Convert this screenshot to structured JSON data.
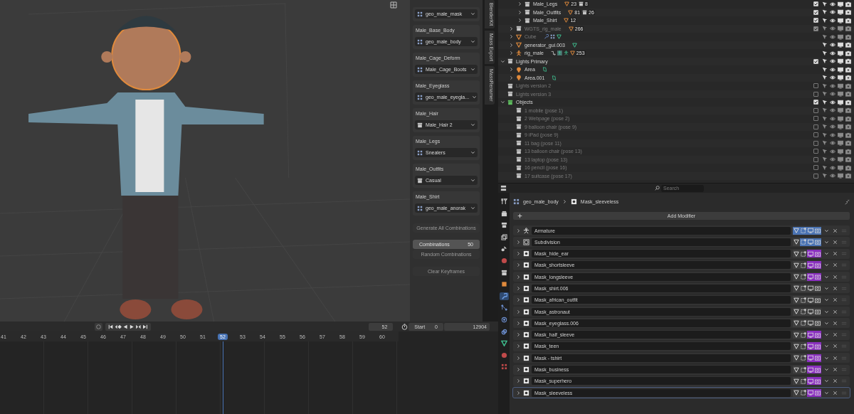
{
  "viewport": {
    "side_panel": {
      "groups": [
        {
          "value": "geo_male_mask",
          "kind": "mesh"
        },
        {
          "label": "Male_Base_Body",
          "value": "geo_male_body",
          "kind": "mesh"
        },
        {
          "label": "Male_Cage_Deform",
          "value": "Male_Cage_Boots",
          "kind": "mesh"
        },
        {
          "label": "Male_Eyeglass",
          "value": "geo_male_eyegla...",
          "kind": "mesh"
        },
        {
          "label": "Male_Hair",
          "value": "Male_Hair 2",
          "kind": "collection"
        },
        {
          "label": "Male_Legs",
          "value": "Snealers",
          "kind": "mesh"
        },
        {
          "label": "Male_Outfits",
          "value": "Casual",
          "kind": "collection"
        },
        {
          "label": "Male_Shirt",
          "value": "geo_male_anorak",
          "kind": "mesh"
        }
      ],
      "actions": [
        {
          "kind": "button",
          "label": "Generate All Combinations",
          "disabled": true
        },
        {
          "kind": "number",
          "label": "Combinations",
          "value": "50",
          "disabled": false
        },
        {
          "kind": "button",
          "label": "Random Combinations",
          "disabled": true
        },
        {
          "kind": "button",
          "label": "Clear Keyframes",
          "disabled": true
        }
      ]
    },
    "tabs": [
      "BlenderKit",
      "Mass Export",
      "MassRenamer"
    ]
  },
  "timeline": {
    "current_frame": "52",
    "start_label": "Start",
    "start": "0",
    "end": "12904",
    "frames": [
      {
        "label": "41",
        "selected": false
      },
      {
        "label": "42",
        "selected": false
      },
      {
        "label": "43",
        "selected": false
      },
      {
        "label": "44",
        "selected": false
      },
      {
        "label": "45",
        "selected": false
      },
      {
        "label": "46",
        "selected": false
      },
      {
        "label": "47",
        "selected": false
      },
      {
        "label": "48",
        "selected": false
      },
      {
        "label": "49",
        "selected": false
      },
      {
        "label": "50",
        "selected": false
      },
      {
        "label": "51",
        "selected": false
      },
      {
        "label": "52",
        "selected": true
      },
      {
        "label": "53",
        "selected": false
      },
      {
        "label": "54",
        "selected": false
      },
      {
        "label": "55",
        "selected": false
      },
      {
        "label": "56",
        "selected": false
      },
      {
        "label": "57",
        "selected": false
      },
      {
        "label": "58",
        "selected": false
      },
      {
        "label": "59",
        "selected": false
      },
      {
        "label": "60",
        "selected": false
      }
    ]
  },
  "outliner": {
    "rows": [
      {
        "children": [
          {
            "children": [
              {
                "label": "Male_Legs",
                "kind": "collection",
                "expanded": false,
                "checked": true,
                "dimmed": false,
                "badges": [
                  {
                    "kind": "mesh",
                    "count": "23"
                  },
                  {
                    "kind": "collection",
                    "count": "8"
                  }
                ]
              },
              {
                "label": "Male_Outfits",
                "kind": "collection",
                "expanded": false,
                "checked": true,
                "dimmed": false,
                "badges": [
                  {
                    "kind": "mesh",
                    "count": "81"
                  },
                  {
                    "kind": "collection",
                    "count": "26"
                  }
                ]
              },
              {
                "label": "Male_Shirt",
                "kind": "collection",
                "expanded": false,
                "checked": true,
                "dimmed": false,
                "badges": [
                  {
                    "kind": "mesh",
                    "count": "12"
                  }
                ]
              }
            ]
          },
          {
            "label": "WGTS_rig_male",
            "kind": "collection",
            "expanded": false,
            "checked": true,
            "dimmed": true,
            "badges": [
              {
                "kind": "mesh",
                "count": "266"
              }
            ]
          },
          {
            "label": "Cube",
            "kind": "mesh",
            "expanded": false,
            "dimmed": true,
            "badges": [
              {
                "kind": "wrench"
              },
              {
                "kind": "modifier"
              },
              {
                "kind": "meshdata"
              }
            ]
          },
          {
            "label": "generator_gui.003",
            "kind": "mesh",
            "expanded": false,
            "dimmed": false,
            "badges": [
              {
                "kind": "meshdata"
              }
            ]
          },
          {
            "label": "rig_male",
            "kind": "armature",
            "expanded": false,
            "dimmed": false,
            "badges": [
              {
                "kind": "constraint"
              },
              {
                "kind": "pose"
              },
              {
                "kind": "armaturedata"
              },
              {
                "kind": "mesh",
                "count": "253"
              }
            ]
          }
        ]
      },
      {
        "label": "Lights Primary",
        "kind": "collection",
        "expanded": true,
        "checked": true,
        "dimmed": false,
        "children": [
          {
            "label": "Area",
            "kind": "light",
            "expanded": false,
            "dimmed": false,
            "badges": [
              {
                "kind": "lightdata"
              }
            ]
          },
          {
            "label": "Area.001",
            "kind": "light",
            "expanded": false,
            "dimmed": false,
            "badges": [
              {
                "kind": "lightdata"
              }
            ]
          }
        ]
      },
      {
        "label": "Lights version 2",
        "kind": "collection",
        "checked": false,
        "dimmed": true
      },
      {
        "label": "Lights version 3",
        "kind": "collection",
        "checked": false,
        "dimmed": true
      },
      {
        "label": "Objects",
        "kind": "greencollection",
        "expanded": true,
        "checked": true,
        "dimmed": false,
        "children": [
          {
            "label": "1 mobile (pose 1)",
            "kind": "collection",
            "checked": false,
            "dimmed": true
          },
          {
            "label": "2 Webpage (pose 2)",
            "kind": "collection",
            "checked": false,
            "dimmed": true
          },
          {
            "label": "9 balloon chair (pose 9)",
            "kind": "collection",
            "checked": false,
            "dimmed": true
          },
          {
            "label": "9 iPad (pose 9)",
            "kind": "collection",
            "checked": false,
            "dimmed": true
          },
          {
            "label": "11 bag (pose 11)",
            "kind": "collection",
            "checked": false,
            "dimmed": true
          },
          {
            "label": "13 balloon chair (pose 13)",
            "kind": "collection",
            "checked": false,
            "dimmed": true
          },
          {
            "label": "13 laptop (pose 13)",
            "kind": "collection",
            "checked": false,
            "dimmed": true
          },
          {
            "label": "16 pencil (pose 16)",
            "kind": "collection",
            "checked": false,
            "dimmed": true
          },
          {
            "label": "17 suitcase (pose 17)",
            "kind": "collection",
            "checked": false,
            "dimmed": true
          }
        ]
      }
    ]
  },
  "properties": {
    "search": {
      "placeholder": "Search"
    },
    "tabs": [
      {
        "kind": "tool",
        "selected": false
      },
      {
        "kind": "render",
        "selected": false
      },
      {
        "kind": "output",
        "selected": false
      },
      {
        "kind": "view_layer",
        "selected": false
      },
      {
        "kind": "scene",
        "selected": false
      },
      {
        "kind": "world",
        "selected": false
      },
      {
        "kind": "collection",
        "selected": false
      },
      {
        "kind": "object",
        "selected": false
      },
      {
        "kind": "modifier",
        "selected": true
      },
      {
        "kind": "particles",
        "selected": false
      },
      {
        "kind": "physics",
        "selected": false
      },
      {
        "kind": "constraints",
        "selected": false
      },
      {
        "kind": "data",
        "selected": false
      },
      {
        "kind": "material",
        "selected": false
      },
      {
        "kind": "texture",
        "selected": false
      }
    ],
    "breadcrumb": [
      {
        "kind": "mesh",
        "label": "geo_male_body"
      },
      {
        "kind": "mask",
        "label": "Mask_sleeveless"
      }
    ],
    "add_button": "Add Modifier",
    "modifiers": [
      {
        "name": "Armature",
        "kind": "armature",
        "on_cage": true,
        "edit_mode": true,
        "realtime": true,
        "render": true,
        "selected": false
      },
      {
        "name": "Subdivision",
        "kind": "subdivision",
        "on_cage": false,
        "edit_mode": true,
        "realtime": true,
        "render": true,
        "selected": false
      },
      {
        "name": "Mask_hide_ear",
        "kind": "mask",
        "on_cage": false,
        "edit_mode": false,
        "realtime": true,
        "render": true,
        "selected": false
      },
      {
        "name": "Mask_shortsleeve",
        "kind": "mask",
        "on_cage": false,
        "edit_mode": false,
        "realtime": true,
        "render": true,
        "selected": false
      },
      {
        "name": "Mask_longsleeve",
        "kind": "mask",
        "on_cage": false,
        "edit_mode": false,
        "realtime": true,
        "render": true,
        "selected": false
      },
      {
        "name": "Mask_shirt.006",
        "kind": "mask",
        "on_cage": false,
        "edit_mode": false,
        "realtime": false,
        "render": false,
        "selected": false
      },
      {
        "name": "Mask_african_outfit",
        "kind": "mask",
        "on_cage": false,
        "edit_mode": false,
        "realtime": false,
        "render": false,
        "selected": false
      },
      {
        "name": "Mask_astronaut",
        "kind": "mask",
        "on_cage": false,
        "edit_mode": false,
        "realtime": false,
        "render": false,
        "selected": false
      },
      {
        "name": "Mask_eyeglass.006",
        "kind": "mask",
        "on_cage": false,
        "edit_mode": false,
        "realtime": false,
        "render": false,
        "selected": false
      },
      {
        "name": "Mask_half_sleeve",
        "kind": "mask",
        "on_cage": false,
        "edit_mode": false,
        "realtime": true,
        "render": true,
        "selected": false
      },
      {
        "name": "Mask_teen",
        "kind": "mask",
        "on_cage": false,
        "edit_mode": false,
        "realtime": true,
        "render": true,
        "selected": false
      },
      {
        "name": "Mask - tshirt",
        "kind": "mask",
        "on_cage": false,
        "edit_mode": false,
        "realtime": true,
        "render": true,
        "selected": false
      },
      {
        "name": "Mask_business",
        "kind": "mask",
        "on_cage": false,
        "edit_mode": false,
        "realtime": true,
        "render": true,
        "selected": false
      },
      {
        "name": "Mask_superhero",
        "kind": "mask",
        "on_cage": false,
        "edit_mode": false,
        "realtime": true,
        "render": true,
        "selected": false
      },
      {
        "name": "Mask_sleeveless",
        "kind": "mask",
        "on_cage": false,
        "edit_mode": false,
        "realtime": true,
        "render": true,
        "selected": true
      }
    ]
  }
}
